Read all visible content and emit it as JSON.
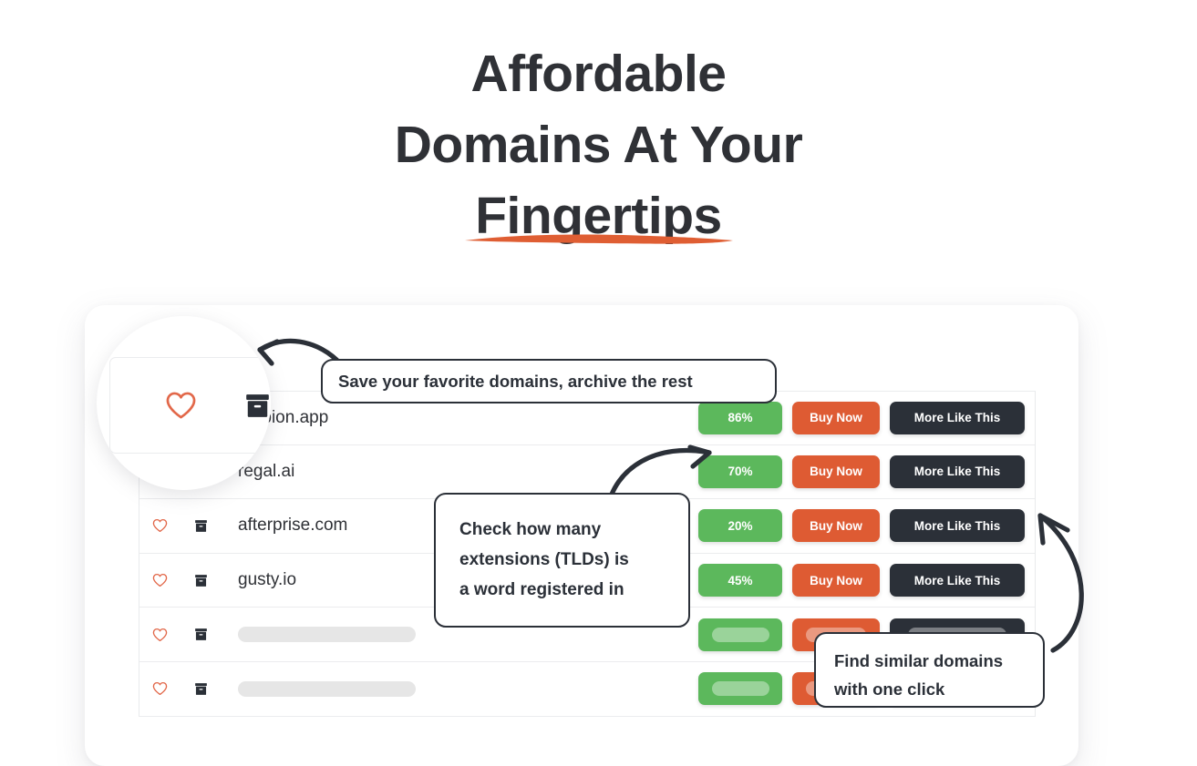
{
  "hero": {
    "line1": "Affordable",
    "line2": "Domains At Your",
    "line3": "Fingertips",
    "underline_color": "#df5e33"
  },
  "theme": {
    "text_dark": "#2f3136",
    "green": "#5cb85c",
    "orange": "#de5b33",
    "dark_button": "#2b3038",
    "heart_red": "#e2684a",
    "skeleton_grey": "#e6e6e6"
  },
  "table": {
    "columns": [
      "favorite",
      "archive",
      "domain",
      "percent",
      "buy",
      "similar"
    ],
    "buy_label": "Buy Now",
    "more_label": "More Like This",
    "rows": [
      {
        "domain": "ampion.app",
        "percent": "86%",
        "buy": "Buy Now",
        "more": "More Like This",
        "placeholder": false
      },
      {
        "domain": "regal.ai",
        "percent": "70%",
        "buy": "Buy Now",
        "more": "More Like This",
        "placeholder": false
      },
      {
        "domain": "afterprise.com",
        "percent": "20%",
        "buy": "Buy Now",
        "more": "More Like This",
        "placeholder": false
      },
      {
        "domain": "gusty.io",
        "percent": "45%",
        "buy": "Buy Now",
        "more": "More Like This",
        "placeholder": false
      },
      {
        "domain": "",
        "percent": "",
        "buy": "",
        "more": "",
        "placeholder": true
      },
      {
        "domain": "",
        "percent": "",
        "buy": "",
        "more": "",
        "placeholder": true
      }
    ]
  },
  "callouts": {
    "favorites": "Save your favorite domains, archive the rest",
    "tlds_line1": "Check how many",
    "tlds_line2": "extensions (TLDs) is",
    "tlds_line3": "a word registered in",
    "similar_line1": "Find similar domains",
    "similar_line2": "with one click"
  },
  "icons": {
    "favorite": "heart-icon",
    "archive": "archive-box-icon",
    "arrow_to_favorites": "curved-arrow-left-icon",
    "arrow_to_percent": "curved-arrow-right-icon",
    "arrow_to_more": "curved-arrow-up-icon"
  }
}
